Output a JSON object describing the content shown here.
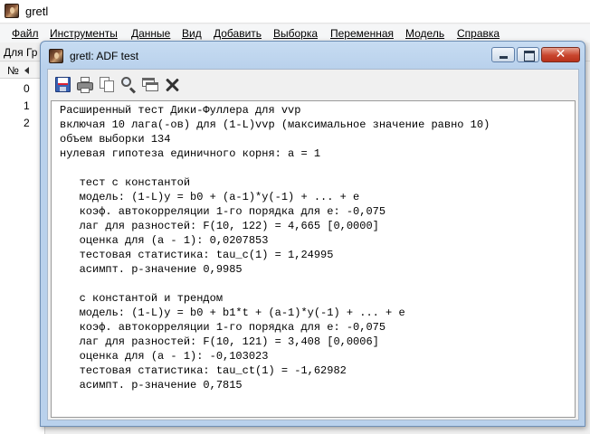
{
  "main_window": {
    "title": "gretl",
    "menu": [
      "Файл",
      "Инструменты",
      "Данные",
      "Вид",
      "Добавить",
      "Выборка",
      "Переменная",
      "Модель",
      "Справка"
    ],
    "toolbar_partial_text": "Для Гр",
    "varlist": {
      "header": "№",
      "rows": [
        "0",
        "1",
        "2"
      ]
    }
  },
  "dialog": {
    "title": "gretl: ADF test",
    "toolbar_icons": [
      "save-icon",
      "print-icon",
      "copy-icon",
      "find-icon",
      "window-list-icon",
      "close-icon"
    ],
    "output_lines": [
      "Расширенный тест Дики-Фуллера для vvp",
      "включая 10 лага(-ов) для (1-L)vvp (максимальное значение равно 10)",
      "объем выборки 134",
      "нулевая гипотеза единичного корня: a = 1",
      "",
      "   тест с константой",
      "   модель: (1-L)y = b0 + (a-1)*y(-1) + ... + e",
      "   коэф. автокорреляции 1-го порядка для e: -0,075",
      "   лаг для разностей: F(10, 122) = 4,665 [0,0000]",
      "   оценка для (a - 1): 0,0207853",
      "   тестовая статистика: tau_c(1) = 1,24995",
      "   асимпт. p-значение 0,9985",
      "",
      "   с константой и трендом",
      "   модель: (1-L)y = b0 + b1*t + (a-1)*y(-1) + ... + e",
      "   коэф. автокорреляции 1-го порядка для e: -0,075",
      "   лаг для разностей: F(10, 121) = 3,408 [0,0006]",
      "   оценка для (a - 1): -0,103023",
      "   тестовая статистика: tau_ct(1) = -1,62982",
      "   асимпт. p-значение 0,7815"
    ]
  },
  "colors": {
    "dialog_frame": "#b9d1ec",
    "close_button": "#c8452d",
    "output_background": "#ffffff"
  }
}
